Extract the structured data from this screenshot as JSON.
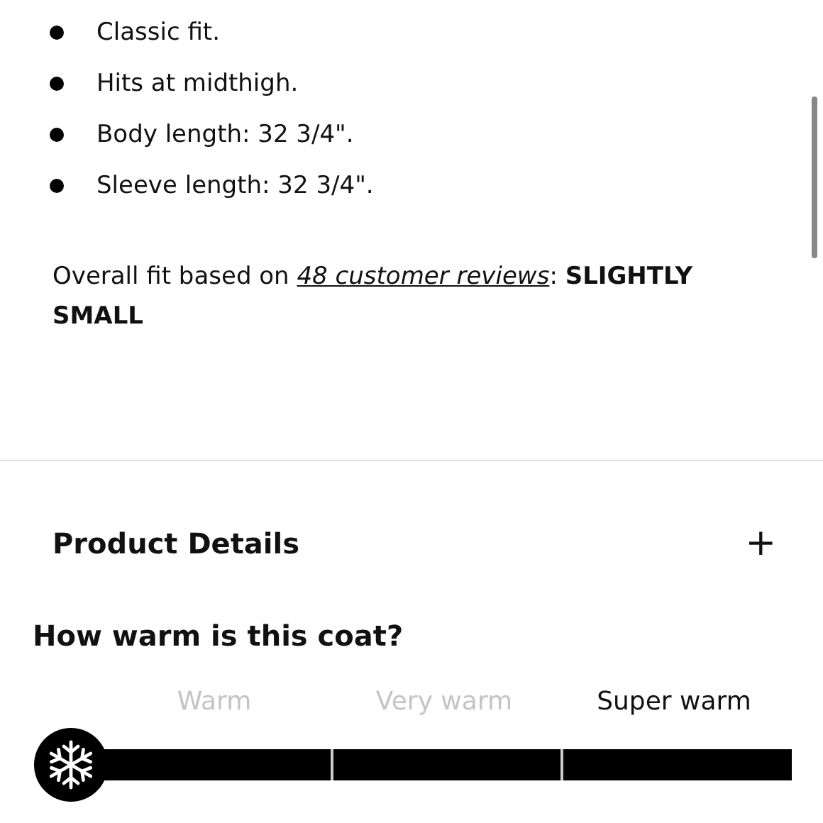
{
  "fit_list": [
    "Classic fit.",
    "Hits at midthigh.",
    "Body length: 32 3/4\".",
    "Sleeve length: 32 3/4\"."
  ],
  "fit_summary": {
    "before": "Overall fit based on",
    "link": "48 customer reviews",
    "after": ":",
    "verdict": "SLIGHTLY SMALL"
  },
  "product_details": {
    "title": "Product Details",
    "toggle": "+",
    "expanded": false
  },
  "warmth": {
    "question": "How warm is this coat?",
    "levels": [
      {
        "label": "Warm",
        "selected": false
      },
      {
        "label": "Very warm",
        "selected": false
      },
      {
        "label": "Super warm",
        "selected": true
      }
    ]
  }
}
